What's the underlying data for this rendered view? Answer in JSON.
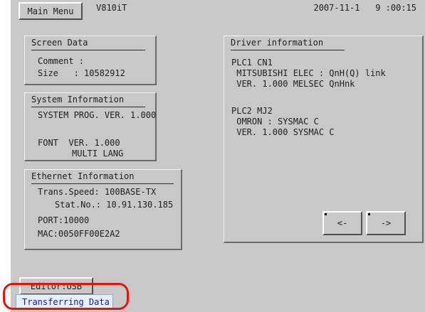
{
  "header": {
    "main_menu_label": "Main Menu",
    "model": "V810iT",
    "date": "2007-11-1",
    "time": "9 :00:15"
  },
  "screen_data": {
    "title": "Screen Data",
    "comment": "Comment :",
    "size": "Size   : 10582912"
  },
  "system_info": {
    "title": "System Information",
    "prog": "SYSTEM PROG. VER. 1.000",
    "font": "FONT  VER. 1.000",
    "multi": "MULTI LANG"
  },
  "ethernet_info": {
    "title": "Ethernet Information",
    "speed": "Trans.Speed: 100BASE-TX",
    "stat": "Stat.No.: 10.91.130.185",
    "port": "PORT:10000",
    "mac": "MAC:0050FF00E2A2"
  },
  "driver_info": {
    "title": "Driver information",
    "plc1_name": "PLC1 CN1",
    "plc1_line1": " MITSUBISHI ELEC : QnH(Q) link",
    "plc1_line2": " VER. 1.000 MELSEC QnHnk",
    "plc2_name": "PLC2 MJ2",
    "plc2_line1": " OMRON : SYSMAC C",
    "plc2_line2": " VER. 1.000 SYSMAC C",
    "prev_label": "<-",
    "next_label": "->"
  },
  "footer": {
    "editor_label": "Editor:USB",
    "status_text": "Transferring Data"
  },
  "colors": {
    "screen_bg": "#c8c8c8",
    "status_bg": "#e4f0fb",
    "highlight": "#e8140c"
  }
}
